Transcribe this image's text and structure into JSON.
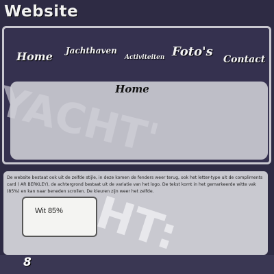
{
  "page_title": "Website",
  "nav": [
    "Home",
    "Jachthaven",
    "Activiteiten",
    "Foto's",
    "Contact"
  ],
  "content_title": "Home",
  "watermark": "YACHT'",
  "description": "De website bestaat ook uit de zelfde stijle, in deze komen de fenders weer terug, ook het letter-type uit de compliments card ( AR BERKLEY), de achtergrond bestaat uit de variatie van het logo. De tekst komt in het gemarkeerde witte vak (85%) en kan naar beneden scrollen. De kleuren zijn weer het zelfde.",
  "swatch_label": "Wit 85%",
  "page_number": "8"
}
